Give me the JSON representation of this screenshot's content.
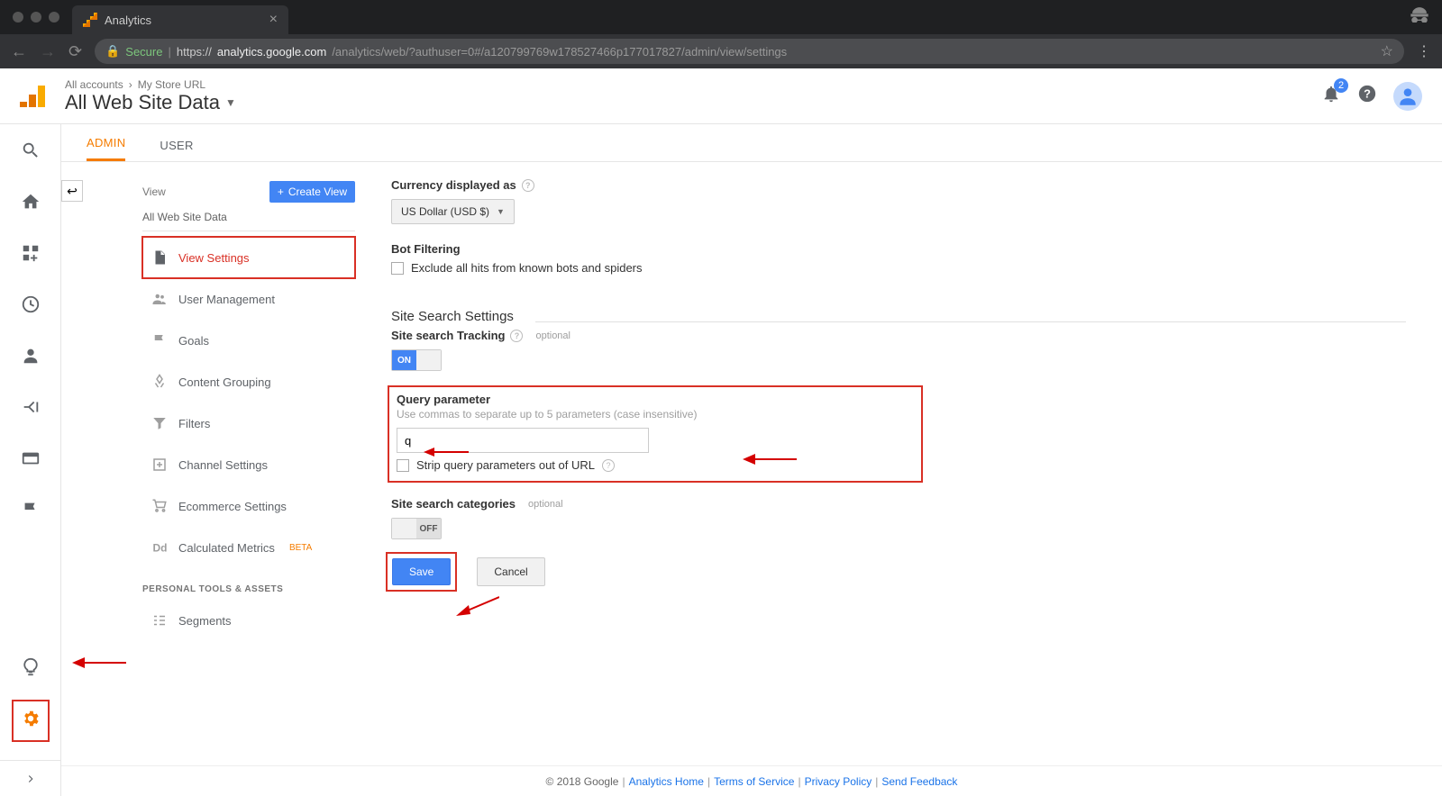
{
  "browser": {
    "tab_title": "Analytics",
    "secure_label": "Secure",
    "url_prefix": "https://",
    "url_host": "analytics.google.com",
    "url_path": "/analytics/web/?authuser=0#/a120799769w178527466p177017827/admin/view/settings"
  },
  "header": {
    "breadcrumb_all": "All accounts",
    "breadcrumb_store": "My Store URL",
    "view_title": "All Web Site Data",
    "notif_count": "2"
  },
  "tabs": {
    "admin": "ADMIN",
    "user": "USER"
  },
  "view_column": {
    "head": "View",
    "create": "Create View",
    "sub": "All Web Site Data",
    "items": [
      "View Settings",
      "User Management",
      "Goals",
      "Content Grouping",
      "Filters",
      "Channel Settings",
      "Ecommerce Settings",
      "Calculated Metrics"
    ],
    "beta": "BETA",
    "personal_head": "PERSONAL TOOLS & ASSETS",
    "segments": "Segments"
  },
  "settings": {
    "currency_label": "Currency displayed as",
    "currency_value": "US Dollar (USD $)",
    "bot_label": "Bot Filtering",
    "bot_check": "Exclude all hits from known bots and spiders",
    "site_search_section": "Site Search Settings",
    "tracking_label": "Site search Tracking",
    "tracking_opt": "optional",
    "toggle_on": "ON",
    "qp_label": "Query parameter",
    "qp_hint": "Use commas to separate up to 5 parameters (case insensitive)",
    "qp_value": "q",
    "strip_label": "Strip query parameters out of URL",
    "cat_label": "Site search categories",
    "cat_opt": "optional",
    "toggle_off": "OFF",
    "save": "Save",
    "cancel": "Cancel"
  },
  "footer": {
    "copyright": "© 2018 Google",
    "links": [
      "Analytics Home",
      "Terms of Service",
      "Privacy Policy",
      "Send Feedback"
    ]
  }
}
